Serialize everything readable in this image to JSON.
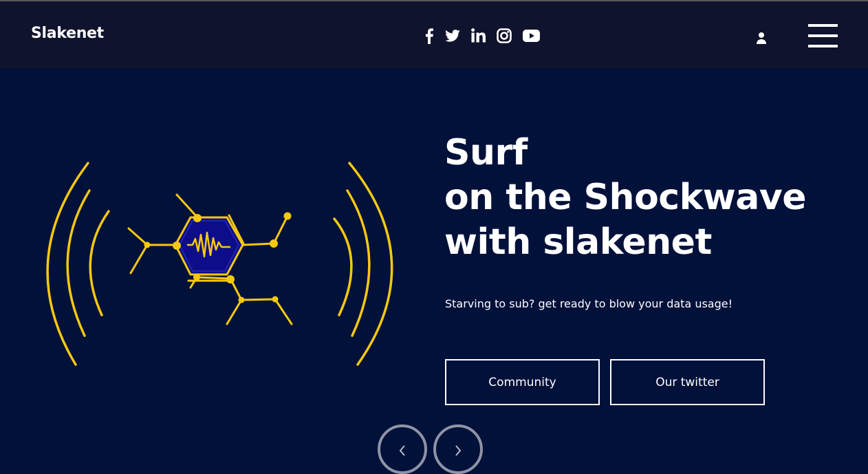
{
  "header": {
    "brand": "Slakenet",
    "social_icons": [
      "facebook-icon",
      "twitter-icon",
      "linkedin-icon",
      "instagram-icon",
      "youtube-icon"
    ],
    "user_icon": "user-icon",
    "menu_icon": "hamburger-menu-icon"
  },
  "hero": {
    "title_lines": [
      "Surf",
      "on the Shockwave",
      "with slakenet"
    ],
    "subtitle": "Starving to sub? get ready to blow your data usage!",
    "buttons": {
      "community": "Community",
      "twitter": "Our twitter"
    },
    "carousel": {
      "prev_icon": "chevron-left-icon",
      "next_icon": "chevron-right-icon"
    }
  },
  "colors": {
    "background": "#01113a",
    "header_background": "#10132d",
    "accent_yellow": "#f6c90e",
    "hexagon_fill": "#0d0d8a",
    "text": "#ffffff"
  }
}
